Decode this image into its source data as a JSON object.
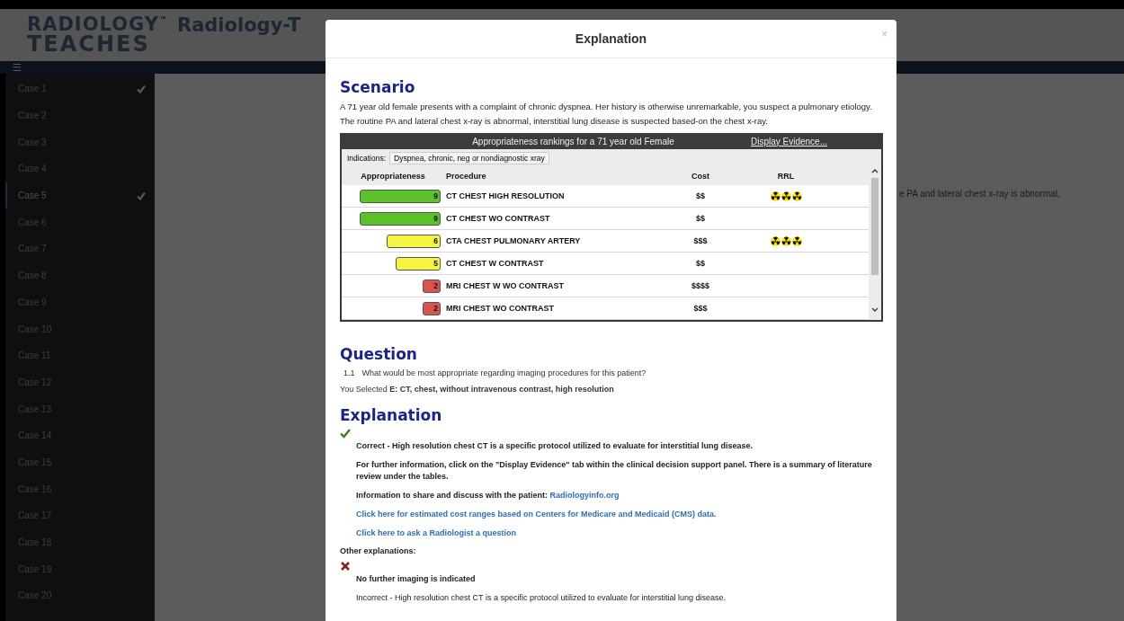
{
  "header": {
    "logo_top": "RADIOLOGY",
    "logo_tm": "™",
    "logo_bottom": "TEACHES",
    "title": "Radiology-T"
  },
  "nav": {
    "menu_glyph": "☰"
  },
  "sidebar": {
    "items": [
      {
        "label": "Case 1",
        "checked": true,
        "selected": false
      },
      {
        "label": "Case 2",
        "checked": false,
        "selected": false
      },
      {
        "label": "Case 3",
        "checked": false,
        "selected": false
      },
      {
        "label": "Case 4",
        "checked": false,
        "selected": false
      },
      {
        "label": "Case 5",
        "checked": true,
        "selected": true
      },
      {
        "label": "Case 6",
        "checked": false,
        "selected": false
      },
      {
        "label": "Case 7",
        "checked": false,
        "selected": false
      },
      {
        "label": "Case 8",
        "checked": false,
        "selected": false
      },
      {
        "label": "Case 9",
        "checked": false,
        "selected": false
      },
      {
        "label": "Case 10",
        "checked": false,
        "selected": false
      },
      {
        "label": "Case 11",
        "checked": false,
        "selected": false
      },
      {
        "label": "Case 12",
        "checked": false,
        "selected": false
      },
      {
        "label": "Case 13",
        "checked": false,
        "selected": false
      },
      {
        "label": "Case 14",
        "checked": false,
        "selected": false
      },
      {
        "label": "Case 15",
        "checked": false,
        "selected": false
      },
      {
        "label": "Case 16",
        "checked": false,
        "selected": false
      },
      {
        "label": "Case 17",
        "checked": false,
        "selected": false
      },
      {
        "label": "Case 18",
        "checked": false,
        "selected": false
      },
      {
        "label": "Case 19",
        "checked": false,
        "selected": false
      },
      {
        "label": "Case 20",
        "checked": false,
        "selected": false
      }
    ]
  },
  "background_text": "e PA and lateral chest x-ray is abnormal,",
  "modal": {
    "title": "Explanation",
    "close": "×",
    "scenario": {
      "heading": "Scenario",
      "text": "A 71 year old female presents with a complaint of chronic dyspnea.  Her history is otherwise unremarkable, you suspect a pulmonary etiology.  The routine PA and lateral chest x-ray is abnormal, interstitial lung disease is suspected based-on the chest x-ray."
    },
    "panel": {
      "title": "Appropriateness rankings for a 71 year old Female",
      "link": "Display Evidence...",
      "indications_label": "Indications:",
      "indication": "Dyspnea, chronic, neg or nondiagnostic xray",
      "columns": [
        "Appropriateness",
        "Procedure",
        "Cost",
        "RRL"
      ],
      "rows": [
        {
          "score": "9",
          "color": "#5cc22a",
          "procedure": "CT CHEST HIGH RESOLUTION",
          "cost": "$$",
          "stars": 3
        },
        {
          "score": "9",
          "color": "#5cc22a",
          "procedure": "CT CHEST WO CONTRAST",
          "cost": "$$"
        },
        {
          "score": "6",
          "color": "#f4f442",
          "procedure": "CTA CHEST PULMONARY ARTERY",
          "cost": "$$$",
          "stars": 3
        },
        {
          "score": "5",
          "color": "#f4f442",
          "procedure": "CT CHEST W CONTRAST",
          "cost": "$$"
        },
        {
          "score": "2",
          "color": "#d9534f",
          "procedure": "MRI CHEST W WO CONTRAST",
          "cost": "$$$$"
        },
        {
          "score": "2",
          "color": "#d9534f",
          "procedure": "MRI CHEST WO CONTRAST",
          "cost": "$$$"
        }
      ]
    },
    "question": {
      "heading": "Question",
      "number": "1.1",
      "text": "What would be most appropriate regarding imaging procedures for this patient?",
      "selected": "You Selected **E: CT, chest, without intravenous contrast, high resolution**"
    },
    "explanation": {
      "heading": "Explanation",
      "correct": {
        "kind": "correct",
        "paragraphs": [
          {
            "kind": "text",
            "text": "Correct - High resolution chest CT is a specific protocol utilized to evaluate for interstitial lung disease."
          },
          {
            "kind": "text",
            "text": "For further information, click on the \"Display Evidence\" tab within the clinical decision support panel.  There is a summary of literature review under the tables."
          },
          {
            "kind": "text_link",
            "text": "Information to share and discuss with the patient:",
            "link": "Radiologyinfo.org"
          },
          {
            "kind": "link",
            "text": "Click here for estimated cost ranges based on Centers for Medicare and Medicaid (CMS) data."
          },
          {
            "kind": "link",
            "text": "Click here to ask a Radiologist a question"
          }
        ]
      },
      "other_label": "Other explanations:",
      "other": {
        "kind": "incorrect",
        "paragraphs": [
          {
            "kind": "text",
            "text": "No further imaging is indicated"
          },
          {
            "kind": "plain",
            "text": "Incorrect - High resolution chest CT is a specific protocol utilized to evaluate for interstitial lung disease."
          }
        ]
      }
    }
  }
}
